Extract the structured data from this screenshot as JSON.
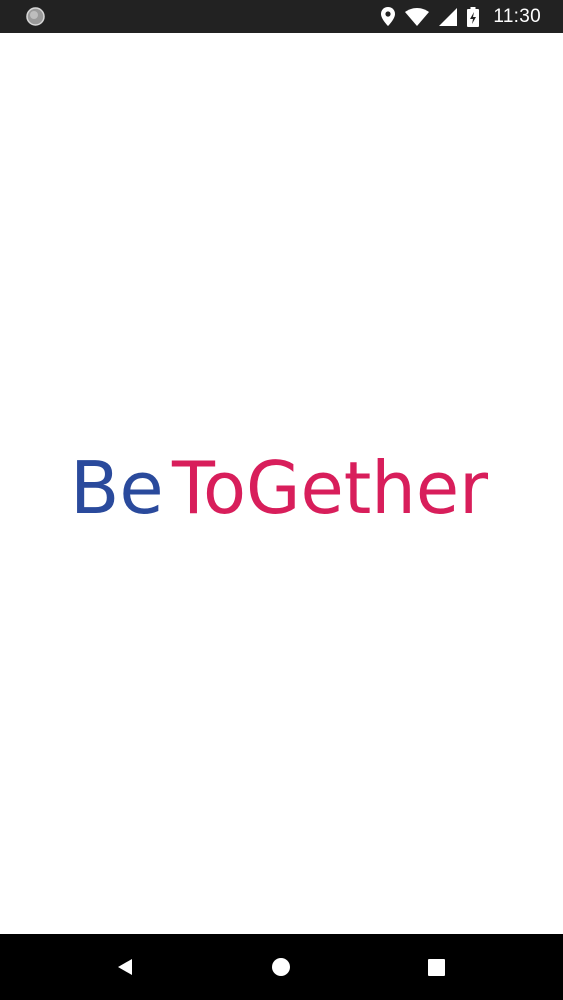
{
  "status_bar": {
    "time": "11:30",
    "icons": [
      "notification-dot-icon",
      "location-icon",
      "wifi-icon",
      "signal-icon",
      "battery-charging-icon"
    ],
    "background": "#222222"
  },
  "splash": {
    "logo_part1": "Be",
    "logo_part2": "ToGether",
    "color_part1": "#2a4a9c",
    "color_part2": "#d81e5b"
  },
  "nav_bar": {
    "icons": [
      "back-icon",
      "home-icon",
      "recents-icon"
    ],
    "background": "#000000"
  }
}
